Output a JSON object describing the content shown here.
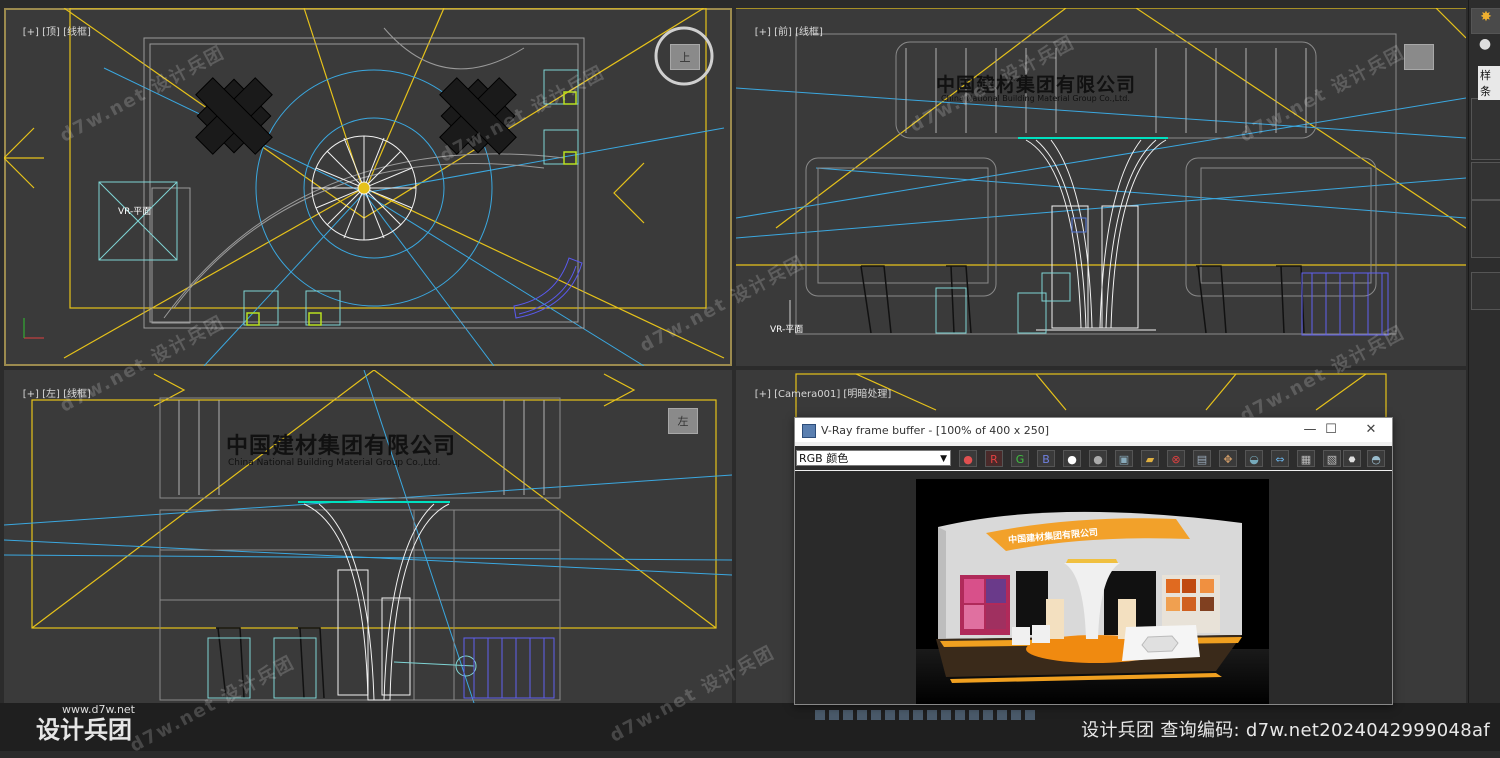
{
  "viewports": {
    "top": {
      "label_plus": "[+]",
      "label_view": "[顶]",
      "label_shade": "[线框]",
      "cube": "上",
      "cam_label": "VR-平面"
    },
    "front": {
      "label_plus": "[+]",
      "label_view": "[前]",
      "label_shade": "[线框]",
      "cam_label": "VR-平面",
      "sign_cn": "中国建材集团有限公司",
      "sign_en": "China National Building Material Group Co.,Ltd."
    },
    "left": {
      "label_plus": "[+]",
      "label_view": "[左]",
      "label_shade": "[线框]",
      "cube": "左",
      "sign_cn": "中国建材集团有限公司",
      "sign_en": "China National Building Material Group Co.,Ltd."
    },
    "camera": {
      "label_plus": "[+]",
      "label_view": "[Camera001]",
      "label_shade": "[明暗处理]"
    }
  },
  "vray": {
    "title": "V-Ray frame buffer - [100% of 400 x 250]",
    "channel": "RGB 颜色",
    "btn_r": "R",
    "btn_g": "G",
    "btn_b": "B",
    "minimize": "—",
    "maximize": "☐",
    "close": "✕",
    "render_sign": "中国建材集团有限公司"
  },
  "right_panel": {
    "text": "样条"
  },
  "watermark": {
    "site": "d7w.net 设计兵团",
    "bottom_text": "设计兵团   查询编码:  d7w.net2024042999048af",
    "logo": "设计兵团",
    "logo_url": "www.d7w.net"
  },
  "colors": {
    "viewport_bg": "#3a3a3a",
    "wire_yellow": "#e6c21a",
    "wire_blue": "#3aa8e0",
    "wire_white": "#e8e8e8",
    "accent_orange": "#f0a020"
  }
}
